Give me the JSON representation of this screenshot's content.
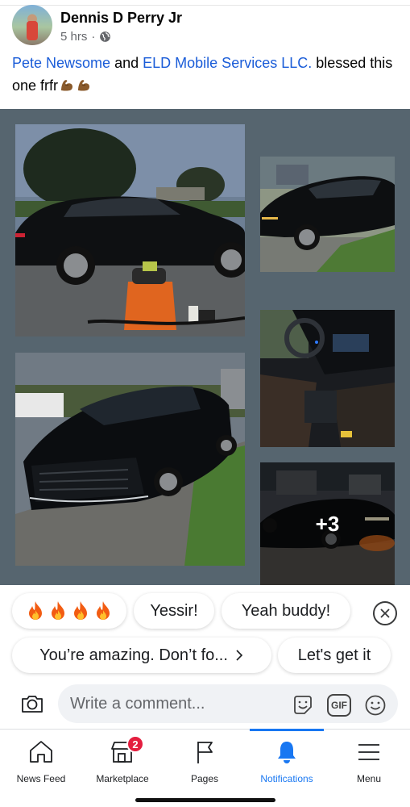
{
  "post": {
    "author": "Dennis D Perry Jr",
    "time": "5 hrs",
    "separator": "·",
    "privacy_icon": "globe-icon",
    "tagged_1": "Pete Newsome",
    "joiner": "and",
    "tagged_2": "ELD Mobile Services LLC.",
    "body": "blessed this one frfr",
    "emojis": [
      "flexed-biceps-emoji",
      "flexed-biceps-emoji"
    ]
  },
  "photos": {
    "more_count": "+3"
  },
  "quick_replies": {
    "flames": [
      "fire-emoji",
      "fire-emoji",
      "fire-emoji",
      "fire-emoji"
    ],
    "reply_2": "Yessir!",
    "reply_3": "Yeah buddy!",
    "reply_4": "You’re amazing. Don’t fo...",
    "reply_5": "Let's get it"
  },
  "comment": {
    "placeholder": "Write a comment...",
    "gif_label": "GIF"
  },
  "nav": {
    "items": [
      {
        "label": "News Feed",
        "icon": "home-icon"
      },
      {
        "label": "Marketplace",
        "icon": "marketplace-icon",
        "badge": "2"
      },
      {
        "label": "Pages",
        "icon": "flag-icon"
      },
      {
        "label": "Notifications",
        "icon": "bell-icon",
        "active": true
      },
      {
        "label": "Menu",
        "icon": "menu-icon"
      }
    ]
  },
  "colors": {
    "accent": "#1877f2",
    "link": "#1a5cd8",
    "badge": "#e41e3f",
    "collage_bg": "#56656f"
  }
}
